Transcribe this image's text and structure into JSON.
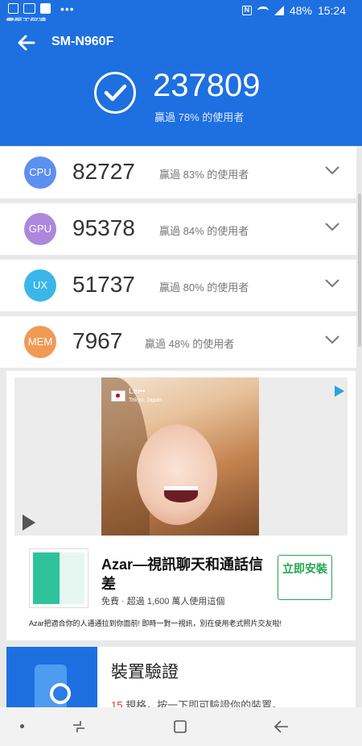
{
  "status_bar": {
    "battery": "48%",
    "time": "15:24"
  },
  "watermark": "電腦王阿達",
  "header": {
    "device": "SM-N960F",
    "total_score": "237809",
    "total_rank": "贏過 78% 的使用者"
  },
  "scores": [
    {
      "label": "CPU",
      "score": "82727",
      "rank": "贏過 83% 的使用者",
      "color": "#5b8ff0"
    },
    {
      "label": "GPU",
      "score": "95378",
      "rank": "贏過 84% 的使用者",
      "color": "#ad87dd"
    },
    {
      "label": "UX",
      "score": "51737",
      "rank": "贏過 80% 的使用者",
      "color": "#3ab6ea"
    },
    {
      "label": "MEM",
      "score": "7967",
      "rank": "贏過 48% 的使用者",
      "color": "#f09a55"
    }
  ],
  "ad": {
    "overlay_name": "Lei••",
    "overlay_location": "Tokyo, Japan",
    "title": "Azar—視訊聊天和通話信差",
    "subtitle": "免費 · 超過 1,600 萬人使用這個",
    "install_label": "立即安裝",
    "description": "Azar把適合你的人通通拉到你面前! 即時一對一視訊，別在使用老式照片交友啦!"
  },
  "verify": {
    "title": "裝置驗證",
    "count": "15",
    "subtitle_rest": " 規格，按一下即可驗證你的裝置。"
  },
  "colors": {
    "accent": "#1e6fe0",
    "install_green": "#23a853"
  },
  "icons": [
    "back-arrow-icon",
    "checkmark-icon",
    "chevron-down-icon",
    "play-icon",
    "adchoices-icon",
    "phone-magnifier-icon"
  ]
}
